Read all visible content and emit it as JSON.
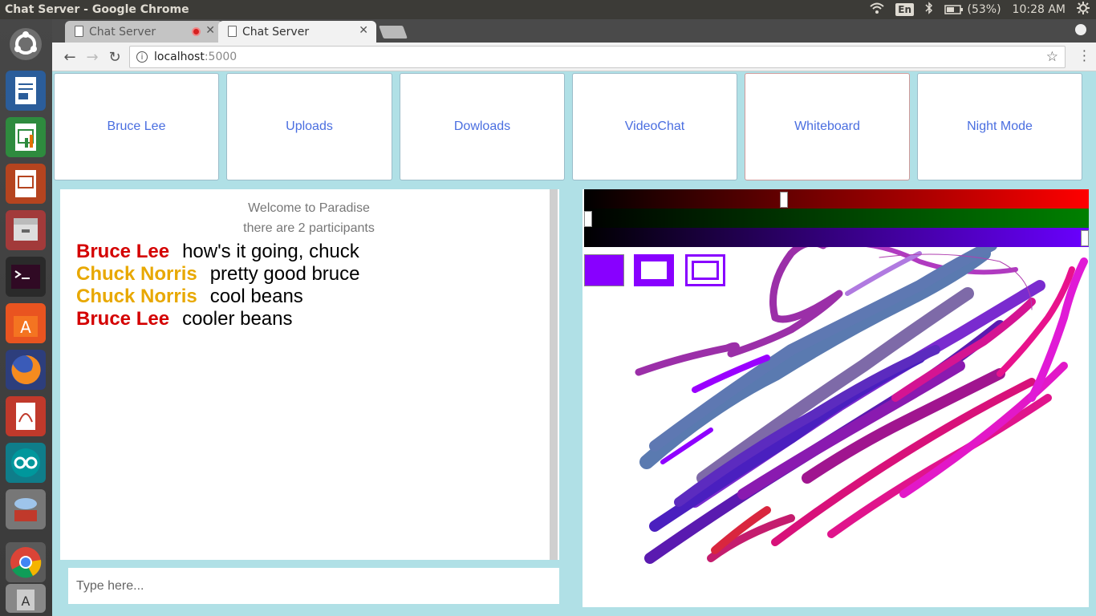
{
  "desktop": {
    "window_title": "Chat Server - Google Chrome",
    "indicators": {
      "keyboard": "En",
      "battery": "(53%)",
      "clock": "10:28 AM"
    }
  },
  "browser": {
    "tabs": [
      {
        "label": "Chat Server",
        "active": false,
        "recording": true
      },
      {
        "label": "Chat Server",
        "active": true,
        "recording": false
      }
    ],
    "url_host": "localhost",
    "url_port": ":5000"
  },
  "nav": {
    "buttons": [
      "Bruce Lee",
      "Uploads",
      "Dowloads",
      "VideoChat",
      "Whiteboard",
      "Night Mode"
    ]
  },
  "chat": {
    "welcome": "Welcome to Paradise",
    "participants": "there are 2 participants",
    "messages": [
      {
        "user": "Bruce Lee",
        "text": "how's it going, chuck",
        "color": "#d40000"
      },
      {
        "user": "Chuck Norris",
        "text": "pretty good bruce",
        "color": "#e8a800"
      },
      {
        "user": "Chuck Norris",
        "text": "cool beans",
        "color": "#e8a800"
      },
      {
        "user": "Bruce Lee",
        "text": "cooler beans",
        "color": "#d40000"
      }
    ],
    "input_placeholder": "Type here..."
  },
  "whiteboard": {
    "sliders": [
      {
        "channel": "red",
        "value": 0.39
      },
      {
        "channel": "green",
        "value": 0.0
      },
      {
        "channel": "blue",
        "value": 1.0
      }
    ],
    "current_color": "#8800ff",
    "tools": [
      "fill-swatch",
      "stroke-medium",
      "stroke-thin"
    ]
  }
}
